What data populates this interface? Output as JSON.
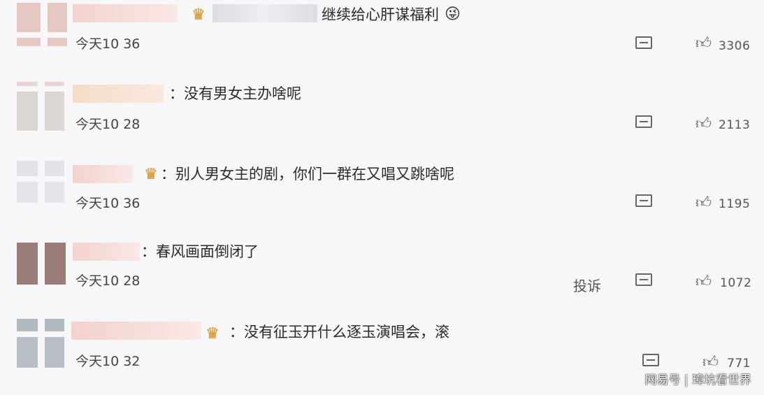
{
  "comments": [
    {
      "text": "继续给心肝谋福利",
      "time": "今天10 36",
      "likes": "3306",
      "has_crown": true,
      "has_report": false,
      "emoji": "😜"
    },
    {
      "text": "：没有男女主办啥呢",
      "time": "今天10 28",
      "likes": "2113",
      "has_crown": false,
      "has_report": false
    },
    {
      "text": "：别人男女主的剧，你们一群在又唱又跳啥呢",
      "time": "今天10 36",
      "likes": "1195",
      "has_crown": true,
      "has_report": false
    },
    {
      "text": "：春风画面倒闭了",
      "time": "今天10 28",
      "likes": "1072",
      "has_crown": false,
      "has_report": true,
      "report_label": "投诉"
    },
    {
      "text": "：没有征玉开什么逐玉演唱会，滚",
      "time": "今天10 32",
      "likes": "771",
      "has_crown": true,
      "has_report": false
    }
  ],
  "watermark": "网易号 | 璋坑看世界",
  "icons": {
    "reply": "reply-icon",
    "like": "thumbs-up-icon",
    "crown": "crown-icon"
  },
  "colors": {
    "background": "#f7f7f9",
    "name_blur": "#f3d2ce",
    "crown": "#e0a338"
  }
}
